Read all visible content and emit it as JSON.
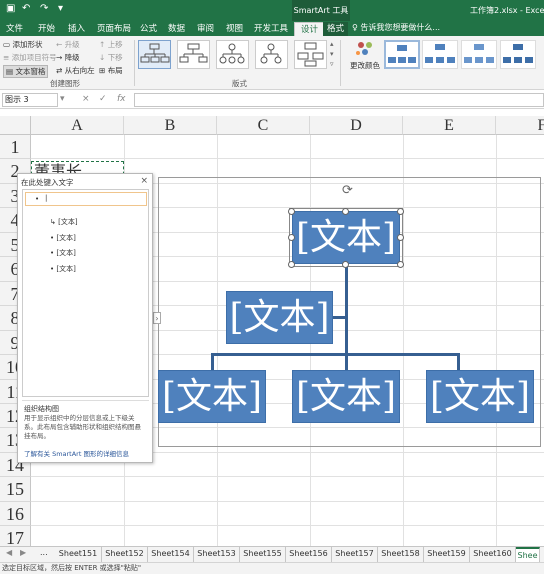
{
  "title_bar": {
    "context_label": "SmartArt 工具",
    "doc_title": "工作簿2.xlsx - Excel(产品"
  },
  "tabs": [
    {
      "label": "文件"
    },
    {
      "label": "开始"
    },
    {
      "label": "插入"
    },
    {
      "label": "页面布局"
    },
    {
      "label": "公式"
    },
    {
      "label": "数据"
    },
    {
      "label": "审阅"
    },
    {
      "label": "视图"
    },
    {
      "label": "开发工具"
    },
    {
      "label": "设计"
    },
    {
      "label": "格式"
    }
  ],
  "tell_me": "告诉我您想要做什么...",
  "ribbon": {
    "create_graphic": {
      "add_shape": "添加形状",
      "add_bullet": "添加项目符号",
      "text_pane": "文本窗格",
      "promote": "升级",
      "demote": "降级",
      "right_to_left": "从右向左",
      "move_up": "上移",
      "move_down": "下移",
      "layout": "布局",
      "group_label": "创建图形"
    },
    "layouts_label": "版式",
    "change_colors": "更改颜色"
  },
  "formula_bar": {
    "name_box": "图示 3",
    "cancel": "×",
    "enter": "✓",
    "fx": "fx"
  },
  "columns": [
    "A",
    "B",
    "C",
    "D",
    "E",
    "F"
  ],
  "rows": [
    "1",
    "2",
    "3",
    "4",
    "5",
    "6",
    "7",
    "8",
    "9",
    "10",
    "11",
    "12",
    "13",
    "14",
    "15",
    "16",
    "17",
    "18"
  ],
  "cell_a2": "董事长",
  "text_pane": {
    "title": "在此处键入文字",
    "close": "×",
    "items": [
      "[文本]",
      "[文本]",
      "[文本]",
      "[文本]"
    ],
    "desc_title": "组织结构图",
    "desc_body": "用于显示组织中的分层信息或上下级关系。此布局包含辅助形状和组织结构图悬挂布局。",
    "link": "了解有关 SmartArt 图形的详细信息"
  },
  "smartart": {
    "node_text": "[文本]"
  },
  "sheets": [
    "Sheet151",
    "Sheet152",
    "Sheet154",
    "Sheet153",
    "Sheet155",
    "Sheet156",
    "Sheet157",
    "Sheet158",
    "Sheet159",
    "Sheet160",
    "Shee"
  ],
  "sheet_more": "...",
  "status": "选定目标区域，然后按 ENTER 或选择\"粘贴\"",
  "colors": {
    "excel_green": "#217346",
    "smartart_fill": "#4f81bd",
    "connector": "#365f91"
  }
}
